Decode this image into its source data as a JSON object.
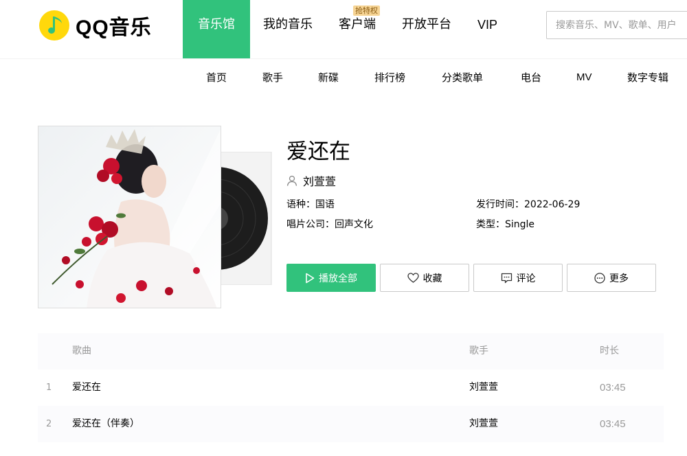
{
  "header": {
    "logo_text": "QQ音乐",
    "nav": [
      {
        "label": "音乐馆",
        "active": true
      },
      {
        "label": "我的音乐",
        "active": false
      },
      {
        "label": "客户端",
        "active": false,
        "badge": "抢特权"
      },
      {
        "label": "开放平台",
        "active": false
      },
      {
        "label": "VIP",
        "active": false
      }
    ],
    "search_placeholder": "搜索音乐、MV、歌单、用户"
  },
  "subnav": [
    "首页",
    "歌手",
    "新碟",
    "排行榜",
    "分类歌单",
    "电台",
    "MV",
    "数字专辑"
  ],
  "album": {
    "title": "爱还在",
    "singer": "刘萱萱",
    "language_label": "语种：",
    "language": "国语",
    "company_label": "唱片公司：",
    "company": "回声文化",
    "release_label": "发行时间：",
    "release_date": "2022-06-29",
    "type_label": "类型：",
    "type": "Single"
  },
  "actions": {
    "play_all": "播放全部",
    "collect": "收藏",
    "comment": "评论",
    "more": "更多"
  },
  "songlist": {
    "headers": {
      "song": "歌曲",
      "singer": "歌手",
      "duration": "时长"
    },
    "rows": [
      {
        "index": "1",
        "title": "爱还在",
        "singer": "刘萱萱",
        "duration": "03:45"
      },
      {
        "index": "2",
        "title": "爱还在（伴奏）",
        "singer": "刘萱萱",
        "duration": "03:45"
      }
    ]
  },
  "colors": {
    "brand_green": "#31c27c",
    "logo_yellow": "#ffd80c",
    "muted_text": "#999999",
    "badge_bg": "#f6d494"
  }
}
